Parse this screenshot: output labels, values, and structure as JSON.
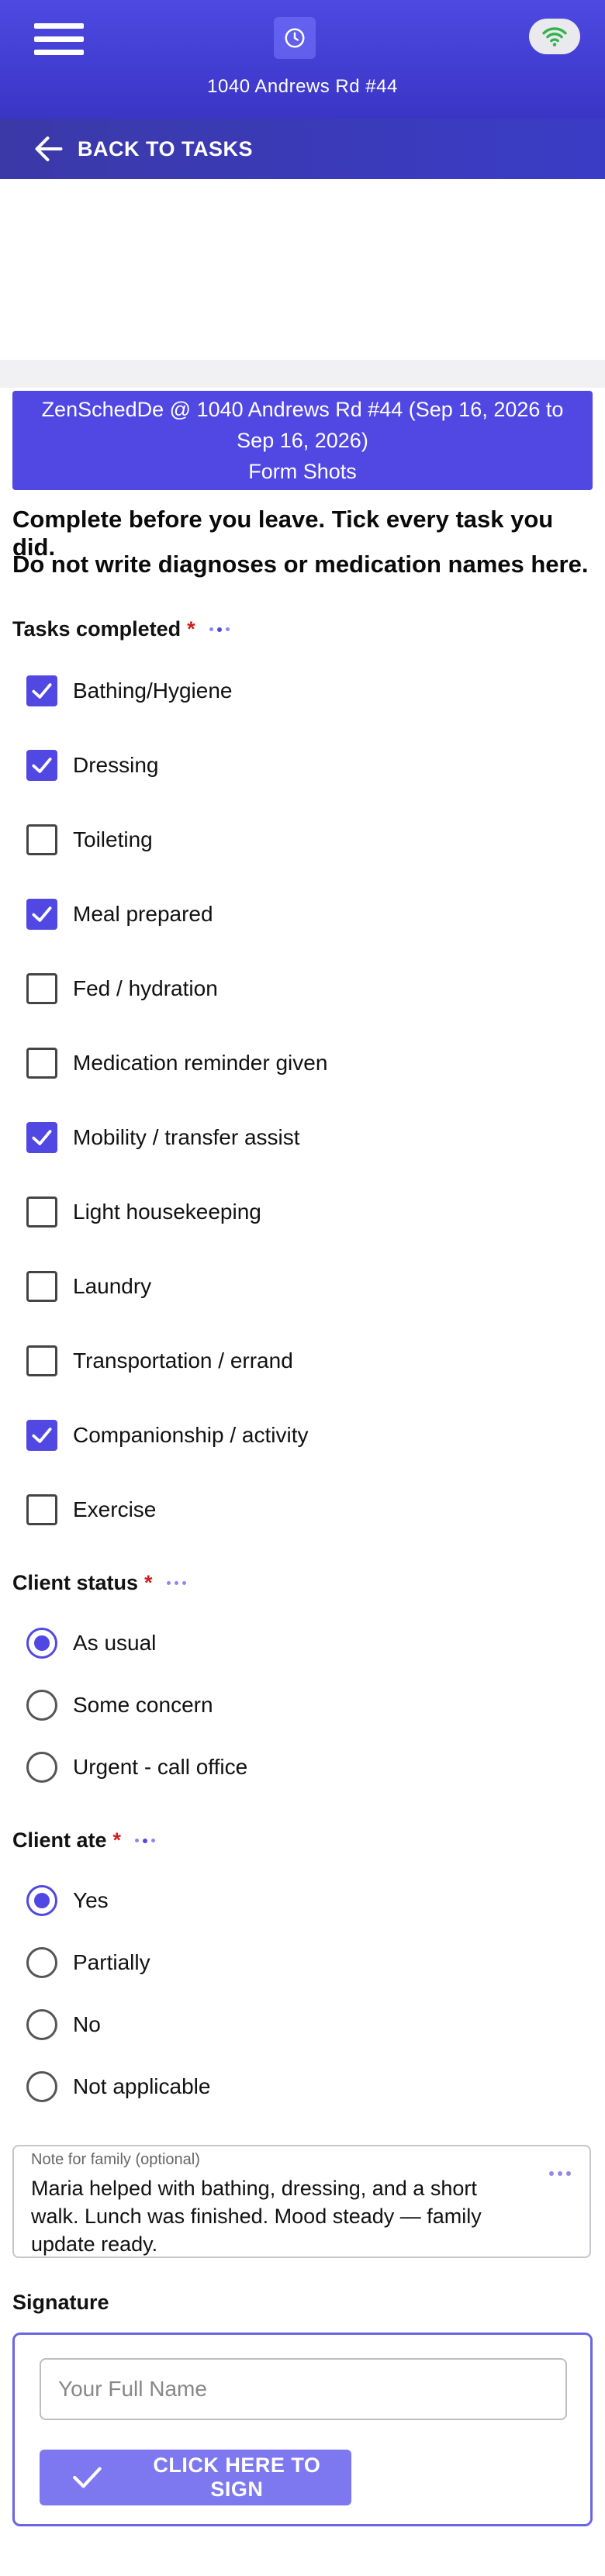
{
  "header": {
    "address": "1040 Andrews Rd #44",
    "menu_icon": "hamburger-menu-icon",
    "logo_icon": "clock-icon",
    "status_icon": "wifi-icon",
    "status_color": "#2fb34a",
    "brand_color": "#5148e4"
  },
  "nav": {
    "back_label": "BACK TO TASKS"
  },
  "banner": {
    "title": "ZenSchedDe @ 1040 Andrews Rd #44 (Sep 16, 2026 to Sep 16, 2026)",
    "subtitle": "Form Shots"
  },
  "instructions": {
    "line1": "Complete before you leave. Tick every task you did.",
    "line2": "Do not write diagnoses or medication names here."
  },
  "tasks": {
    "label": "Tasks completed",
    "required_mark": "*",
    "items": [
      {
        "label": "Bathing/Hygiene",
        "checked": true
      },
      {
        "label": "Dressing",
        "checked": true
      },
      {
        "label": "Toileting",
        "checked": false
      },
      {
        "label": "Meal prepared",
        "checked": true
      },
      {
        "label": "Fed / hydration",
        "checked": false
      },
      {
        "label": "Medication reminder given",
        "checked": false
      },
      {
        "label": "Mobility / transfer assist",
        "checked": true
      },
      {
        "label": "Light housekeeping",
        "checked": false
      },
      {
        "label": "Laundry",
        "checked": false
      },
      {
        "label": "Transportation / errand",
        "checked": false
      },
      {
        "label": "Companionship / activity",
        "checked": true
      },
      {
        "label": "Exercise",
        "checked": false
      }
    ]
  },
  "client_status": {
    "label": "Client status",
    "required_mark": "*",
    "options": [
      {
        "label": "As usual",
        "selected": true
      },
      {
        "label": "Some concern",
        "selected": false
      },
      {
        "label": "Urgent - call office",
        "selected": false
      }
    ]
  },
  "client_ate": {
    "label": "Client ate",
    "required_mark": "*",
    "options": [
      {
        "label": "Yes",
        "selected": true
      },
      {
        "label": "Partially",
        "selected": false
      },
      {
        "label": "No",
        "selected": false
      },
      {
        "label": "Not applicable",
        "selected": false
      }
    ]
  },
  "note": {
    "label": "Note for family (optional)",
    "value": "Maria helped with bathing, dressing, and a short walk. Lunch was finished. Mood steady — family update ready."
  },
  "signature": {
    "label": "Signature",
    "name_placeholder": "Your Full Name",
    "name_value": "",
    "sign_button": "CLICK HERE TO SIGN"
  }
}
